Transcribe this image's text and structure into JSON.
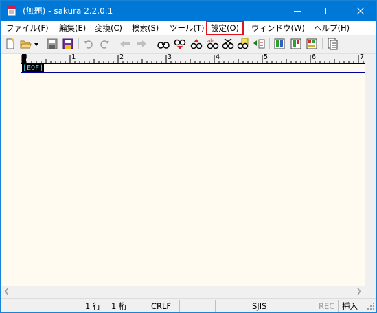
{
  "window": {
    "title": "(無題) - sakura 2.2.0.1"
  },
  "menu": {
    "items": [
      {
        "label": "ファイル(F)",
        "name": "menu-file"
      },
      {
        "label": "編集(E)",
        "name": "menu-edit"
      },
      {
        "label": "変換(C)",
        "name": "menu-convert"
      },
      {
        "label": "検索(S)",
        "name": "menu-search"
      },
      {
        "label": "ツール(T)",
        "name": "menu-tool"
      },
      {
        "label": "設定(O)",
        "name": "menu-settings"
      },
      {
        "label": "ウィンドウ(W)",
        "name": "menu-window"
      },
      {
        "label": "ヘルプ(H)",
        "name": "menu-help"
      }
    ],
    "highlighted": "menu-settings"
  },
  "toolbar": {
    "icons": [
      "new-file-icon",
      "open-folder-icon",
      "dropdown-arrow-icon",
      "save-icon",
      "save-all-icon",
      "undo-icon",
      "redo-icon",
      "jump-back-icon",
      "jump-forward-icon",
      "search-icon",
      "search-next-icon",
      "search-prev-icon",
      "replace-icon",
      "search-clear-icon",
      "grep-icon",
      "compare-icon",
      "outline-icon",
      "rectangle-select-icon",
      "function-list-icon",
      "print-icon"
    ]
  },
  "editor": {
    "ruler_labels": [
      "0",
      "1",
      "2",
      "3",
      "4",
      "5",
      "6",
      "7"
    ],
    "eof_marker": "[EOF]",
    "background": "#fffbf0"
  },
  "status": {
    "line": "1 行",
    "column": "1 桁",
    "newline": "CRLF",
    "encoding": "SJIS",
    "rec": "REC",
    "mode": "挿入"
  },
  "colors": {
    "titlebar": "#0078d7",
    "highlight_border": "#e0141e",
    "eof_text": "#4fd8f0"
  }
}
